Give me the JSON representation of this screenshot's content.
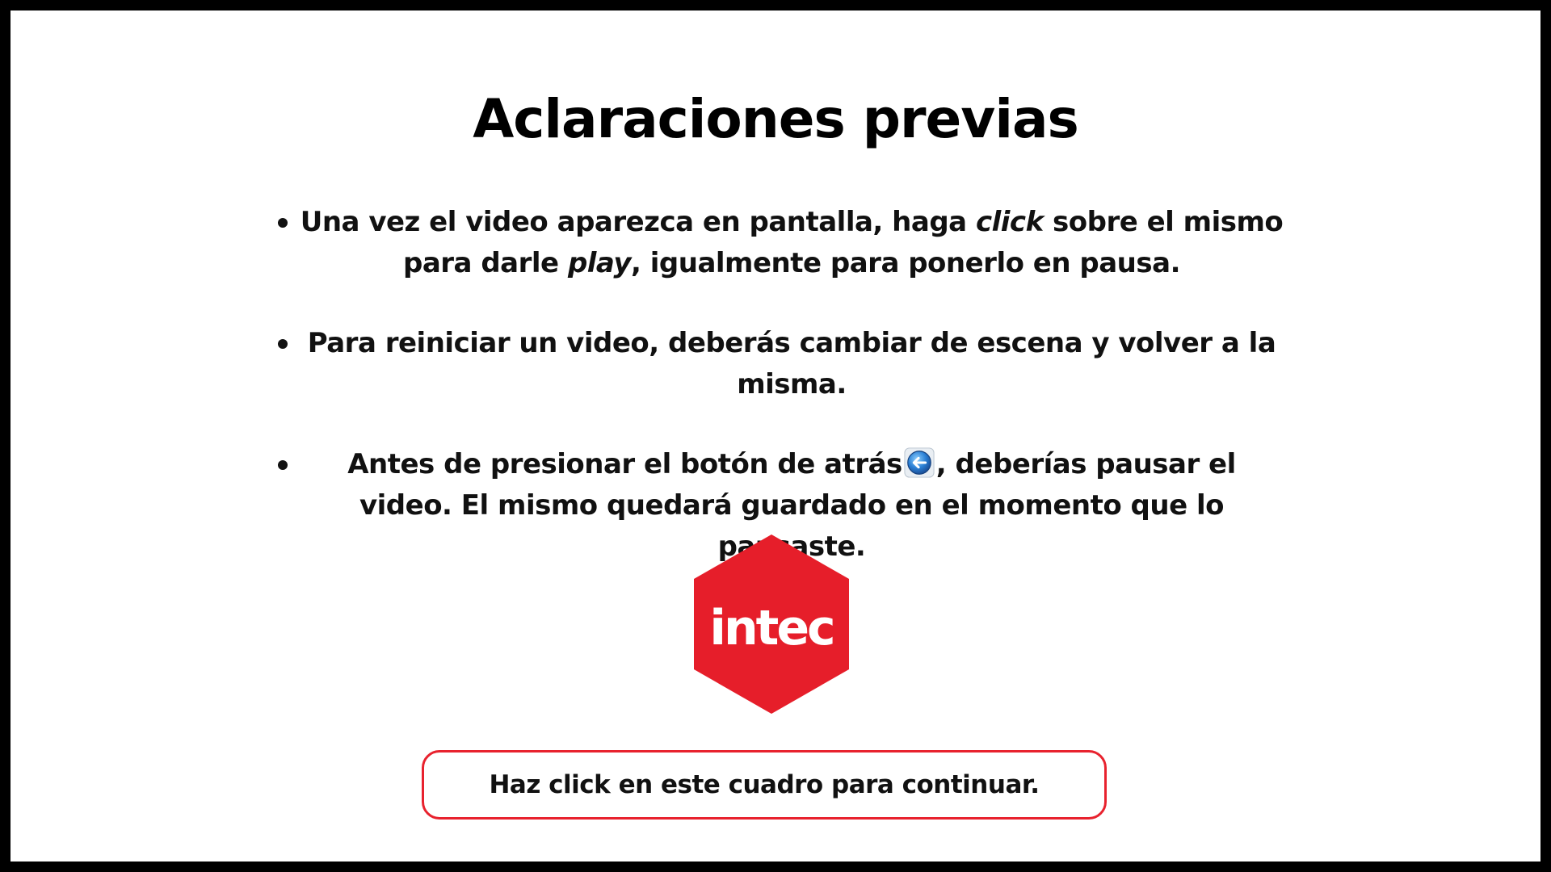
{
  "title": "Aclaraciones previas",
  "bullets": [
    {
      "part1": "Una vez el video aparezca en pantalla, haga ",
      "em1": "click",
      "part2": " sobre el mismo para darle ",
      "em2": "play",
      "part3": ", igualmente para ponerlo en pausa."
    },
    {
      "text": "Para reiniciar un video, deberás cambiar de escena y volver a la misma."
    },
    {
      "part1": "Antes de presionar el botón de atrás",
      "part2": ", deberías pausar el video. El mismo quedará guardado en el momento que lo pausaste."
    }
  ],
  "logo": {
    "text": "intec",
    "color": "#e61e2a"
  },
  "continue_button": {
    "label": "Haz click en este cuadro para continuar.",
    "border_color": "#e8222e"
  },
  "icons": {
    "back": "back-arrow-icon"
  }
}
